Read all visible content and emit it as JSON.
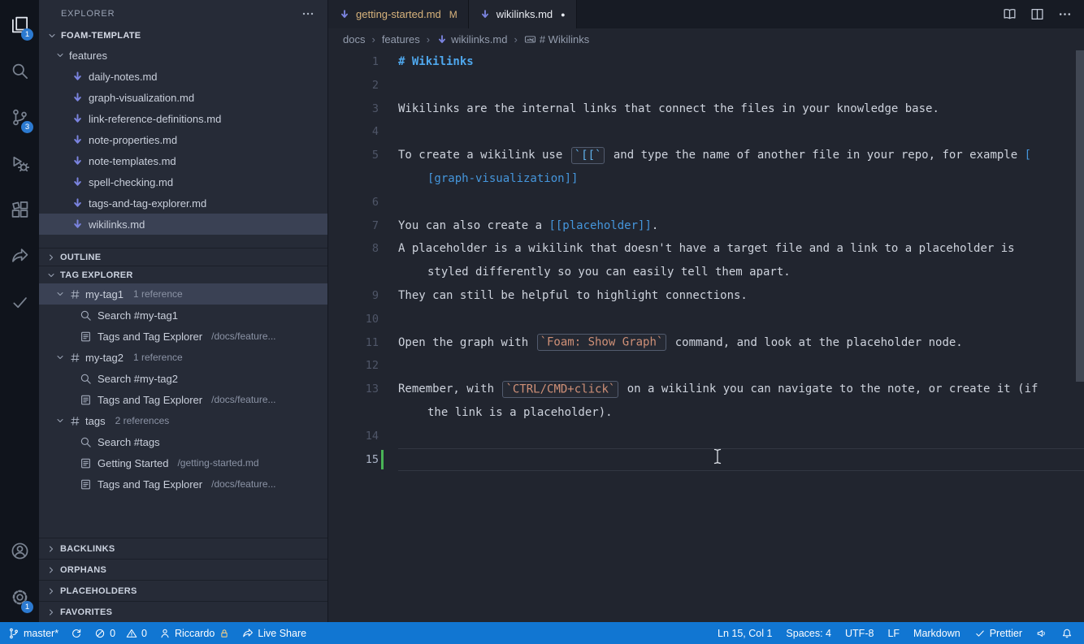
{
  "activity_bar": {
    "items": [
      {
        "icon": "explorer",
        "label": "Explorer",
        "badge": "1",
        "active": true
      },
      {
        "icon": "search",
        "label": "Search"
      },
      {
        "icon": "source-control",
        "label": "Source Control",
        "badge": "3"
      },
      {
        "icon": "run-debug",
        "label": "Run and Debug"
      },
      {
        "icon": "extensions",
        "label": "Extensions"
      },
      {
        "icon": "live-share",
        "label": "Live Share"
      },
      {
        "icon": "checklist",
        "label": "Checklist"
      }
    ],
    "bottom_items": [
      {
        "icon": "account",
        "label": "Accounts"
      },
      {
        "icon": "settings",
        "label": "Settings",
        "badge": "1"
      }
    ]
  },
  "sidebar": {
    "header": {
      "title": "EXPLORER"
    },
    "project_section": {
      "label": "FOAM-TEMPLATE"
    },
    "file_tree": [
      {
        "label": "features",
        "kind": "folder"
      },
      {
        "label": "daily-notes.md",
        "kind": "md"
      },
      {
        "label": "graph-visualization.md",
        "kind": "md"
      },
      {
        "label": "link-reference-definitions.md",
        "kind": "md"
      },
      {
        "label": "note-properties.md",
        "kind": "md"
      },
      {
        "label": "note-templates.md",
        "kind": "md"
      },
      {
        "label": "spell-checking.md",
        "kind": "md"
      },
      {
        "label": "tags-and-tag-explorer.md",
        "kind": "md"
      },
      {
        "label": "wikilinks.md",
        "kind": "md",
        "selected": true
      }
    ],
    "outline_section": {
      "label": "OUTLINE"
    },
    "tag_explorer": {
      "label": "TAG EXPLORER",
      "tags": [
        {
          "name": "my-tag1",
          "meta": "1 reference",
          "selected": true,
          "children": [
            {
              "icon": "search",
              "label": "Search #my-tag1"
            },
            {
              "icon": "report",
              "label": "Tags and Tag Explorer",
              "detail": "/docs/feature..."
            }
          ]
        },
        {
          "name": "my-tag2",
          "meta": "1 reference",
          "children": [
            {
              "icon": "search",
              "label": "Search #my-tag2"
            },
            {
              "icon": "report",
              "label": "Tags and Tag Explorer",
              "detail": "/docs/feature..."
            }
          ]
        },
        {
          "name": "tags",
          "meta": "2 references",
          "children": [
            {
              "icon": "search",
              "label": "Search #tags"
            },
            {
              "icon": "report",
              "label": "Getting Started",
              "detail": "/getting-started.md"
            },
            {
              "icon": "report",
              "label": "Tags and Tag Explorer",
              "detail": "/docs/feature..."
            }
          ]
        }
      ]
    },
    "bottom_sections": [
      {
        "label": "BACKLINKS"
      },
      {
        "label": "ORPHANS"
      },
      {
        "label": "PLACEHOLDERS"
      },
      {
        "label": "FAVORITES"
      }
    ]
  },
  "editor": {
    "tabs": [
      {
        "label": "getting-started.md",
        "indicator": "M",
        "state": "modified"
      },
      {
        "label": "wikilinks.md",
        "indicator": "●",
        "state": "active"
      }
    ],
    "breadcrumb": [
      "docs",
      "features",
      "wikilinks.md",
      "# Wikilinks"
    ],
    "breadcrumb_separator": "›",
    "rows": [
      {
        "num": "1",
        "segs": [
          {
            "t": "# Wikilinks",
            "s": "heading"
          }
        ]
      },
      {
        "num": "2",
        "segs": []
      },
      {
        "num": "3",
        "segs": [
          {
            "t": "Wikilinks are the internal links that connect the files in your knowledge base.",
            "s": "plain"
          }
        ]
      },
      {
        "num": "4",
        "segs": []
      },
      {
        "num": "5",
        "segs": [
          {
            "t": "To create a wikilink use ",
            "s": "plain"
          },
          {
            "t": "`[[`",
            "s": "code-blue"
          },
          {
            "t": " and type the name of another file in your repo, for example ",
            "s": "plain"
          },
          {
            "t": "[",
            "s": "link"
          }
        ]
      },
      {
        "num": "",
        "wrap": true,
        "segs": [
          {
            "t": "[graph-visualization]]",
            "s": "link"
          }
        ]
      },
      {
        "num": "6",
        "segs": []
      },
      {
        "num": "7",
        "segs": [
          {
            "t": "You can also create a ",
            "s": "plain"
          },
          {
            "t": "[[placeholder]]",
            "s": "link"
          },
          {
            "t": ".",
            "s": "plain"
          }
        ]
      },
      {
        "num": "8",
        "segs": [
          {
            "t": "A placeholder is a wikilink that doesn't have a target file and a link to a placeholder is",
            "s": "plain"
          }
        ]
      },
      {
        "num": "",
        "wrap": true,
        "segs": [
          {
            "t": "styled differently so you can easily tell them apart.",
            "s": "plain"
          }
        ]
      },
      {
        "num": "9",
        "segs": [
          {
            "t": "They can still be helpful to highlight connections.",
            "s": "plain"
          }
        ]
      },
      {
        "num": "10",
        "segs": []
      },
      {
        "num": "11",
        "segs": [
          {
            "t": "Open the graph with ",
            "s": "plain"
          },
          {
            "t": "`Foam: Show Graph`",
            "s": "code-orange"
          },
          {
            "t": " command, and look at the placeholder node.",
            "s": "plain"
          }
        ]
      },
      {
        "num": "12",
        "segs": []
      },
      {
        "num": "13",
        "segs": [
          {
            "t": "Remember, with ",
            "s": "plain"
          },
          {
            "t": "`CTRL/CMD+click`",
            "s": "code-orange"
          },
          {
            "t": " on a wikilink you can navigate to the note, or create it (if",
            "s": "plain"
          }
        ]
      },
      {
        "num": "",
        "wrap": true,
        "segs": [
          {
            "t": "the link is a placeholder).",
            "s": "plain"
          }
        ]
      },
      {
        "num": "14",
        "segs": []
      },
      {
        "num": "15",
        "segs": [],
        "current": true,
        "gutter_added": true
      }
    ]
  },
  "status_bar": {
    "branch": "master*",
    "errors": "0",
    "warnings": "0",
    "user": "Riccardo",
    "live_share": "Live Share",
    "cursor_position": "Ln 15, Col 1",
    "indentation": "Spaces: 4",
    "encoding": "UTF-8",
    "eol": "LF",
    "language": "Markdown",
    "formatter": "Prettier"
  }
}
